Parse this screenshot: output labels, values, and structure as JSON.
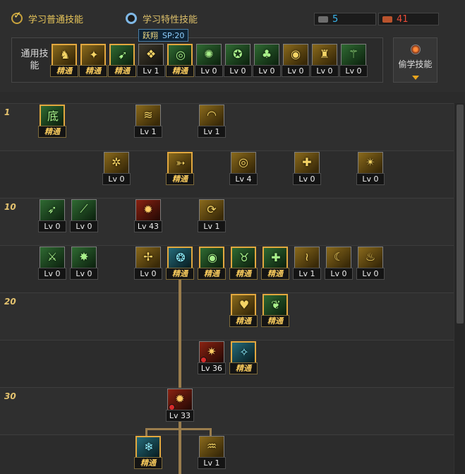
{
  "header": {
    "tabs": [
      {
        "label": "学习普通技能",
        "selected": true
      },
      {
        "label": "学习特性技能",
        "selected": false
      }
    ],
    "resources": [
      {
        "icon": "sp-icon",
        "value": "5",
        "color": "#3ab8f0"
      },
      {
        "icon": "tp-icon",
        "value": "41",
        "color": "#ea4b37"
      }
    ],
    "tooltip": {
      "name": "跃翔",
      "sp": "SP:20"
    },
    "common_label": "通用技能",
    "steal_label": "偷学技能"
  },
  "common_skills": [
    {
      "icon": "kneel-icon",
      "tag": "精通",
      "master": true,
      "style": "gold"
    },
    {
      "icon": "throw-icon",
      "tag": "精通",
      "master": true,
      "style": "gold"
    },
    {
      "icon": "run-icon",
      "tag": "精通",
      "master": true,
      "style": "green"
    },
    {
      "icon": "wing-icon",
      "tag": "Lv 1",
      "master": false,
      "style": "dark"
    },
    {
      "icon": "target-icon",
      "tag": "精通",
      "master": true,
      "style": "green"
    },
    {
      "icon": "aura-icon",
      "tag": "Lv 0",
      "master": false,
      "style": "green"
    },
    {
      "icon": "shout-icon",
      "tag": "Lv 0",
      "master": false,
      "style": "green"
    },
    {
      "icon": "mushroom-icon",
      "tag": "Lv 0",
      "master": false,
      "style": "green"
    },
    {
      "icon": "eye-icon",
      "tag": "Lv 0",
      "master": false,
      "style": "gold"
    },
    {
      "icon": "flex-icon",
      "tag": "Lv 0",
      "master": false,
      "style": "gold"
    },
    {
      "icon": "mage-icon",
      "tag": "Lv 0",
      "master": false,
      "style": "green"
    }
  ],
  "level_labels": [
    "1",
    "",
    "10",
    "",
    "20",
    "",
    "30",
    ""
  ],
  "tree_skills": [
    {
      "row": 0,
      "col": 56,
      "icon": "base-kick-icon",
      "glyph_text": "底",
      "tag": "精通",
      "master": true,
      "style": "green"
    },
    {
      "row": 0,
      "col": 192,
      "icon": "slash-icon",
      "tag": "Lv 1",
      "master": false,
      "style": "gold"
    },
    {
      "row": 0,
      "col": 282,
      "icon": "arc-icon",
      "tag": "Lv 1",
      "master": false,
      "style": "gold"
    },
    {
      "row": 1,
      "col": 147,
      "icon": "burst-icon",
      "tag": "Lv 0",
      "master": false,
      "style": "gold"
    },
    {
      "row": 1,
      "col": 237,
      "icon": "dash-icon",
      "tag": "精通",
      "master": true,
      "style": "gold"
    },
    {
      "row": 1,
      "col": 327,
      "icon": "whirl-icon",
      "tag": "Lv 4",
      "master": false,
      "style": "gold"
    },
    {
      "row": 1,
      "col": 417,
      "icon": "shield-icon",
      "tag": "Lv 0",
      "master": false,
      "style": "gold"
    },
    {
      "row": 1,
      "col": 507,
      "icon": "fan-icon",
      "tag": "Lv 0",
      "master": false,
      "style": "gold"
    },
    {
      "row": 2,
      "col": 56,
      "icon": "spear-icon",
      "tag": "Lv 0",
      "master": false,
      "style": "green"
    },
    {
      "row": 2,
      "col": 101,
      "icon": "blade-icon",
      "tag": "Lv 0",
      "master": false,
      "style": "green"
    },
    {
      "row": 2,
      "col": 192,
      "icon": "fire-icon",
      "tag": "Lv 43",
      "master": false,
      "style": "red"
    },
    {
      "row": 2,
      "col": 282,
      "icon": "spin-icon",
      "tag": "Lv 1",
      "master": false,
      "style": "gold"
    },
    {
      "row": 3,
      "col": 56,
      "icon": "sword-icon",
      "tag": "Lv 0",
      "master": false,
      "style": "green"
    },
    {
      "row": 3,
      "col": 101,
      "icon": "star-burst-icon",
      "tag": "Lv 0",
      "master": false,
      "style": "green"
    },
    {
      "row": 3,
      "col": 192,
      "icon": "cross-slash-icon",
      "tag": "Lv 0",
      "master": false,
      "style": "gold"
    },
    {
      "row": 3,
      "col": 237,
      "icon": "orb-icon",
      "tag": "精通",
      "master": true,
      "style": "cyan"
    },
    {
      "row": 3,
      "col": 282,
      "icon": "green-eye-icon",
      "tag": "精通",
      "master": true,
      "style": "green"
    },
    {
      "row": 3,
      "col": 327,
      "icon": "beast-icon",
      "tag": "精通",
      "master": true,
      "style": "green"
    },
    {
      "row": 3,
      "col": 372,
      "icon": "heal-cross-icon",
      "tag": "精通",
      "master": true,
      "style": "green"
    },
    {
      "row": 3,
      "col": 417,
      "icon": "claw-icon",
      "tag": "Lv 1",
      "master": false,
      "style": "gold"
    },
    {
      "row": 3,
      "col": 462,
      "icon": "moon-icon",
      "tag": "Lv 0",
      "master": false,
      "style": "gold"
    },
    {
      "row": 3,
      "col": 507,
      "icon": "flame-icon",
      "tag": "Lv 0",
      "master": false,
      "style": "gold"
    },
    {
      "row": 4,
      "col": 327,
      "icon": "heart-shield-icon",
      "tag": "精通",
      "master": true,
      "style": "gold"
    },
    {
      "row": 4,
      "col": 372,
      "icon": "vine-icon",
      "tag": "精通",
      "master": true,
      "style": "green"
    },
    {
      "row": 5,
      "col": 282,
      "icon": "explode-icon",
      "tag": "Lv 36",
      "master": false,
      "style": "red",
      "warn": true
    },
    {
      "row": 5,
      "col": 327,
      "icon": "ice-warrior-icon",
      "tag": "精通",
      "master": true,
      "style": "cyan"
    },
    {
      "row": 6,
      "col": 237,
      "icon": "ultimate-icon",
      "tag": "Lv 33",
      "master": false,
      "style": "red",
      "warn": true
    },
    {
      "row": 7,
      "col": 192,
      "icon": "frost-beast-icon",
      "tag": "精通",
      "master": true,
      "style": "cyan"
    },
    {
      "row": 7,
      "col": 282,
      "icon": "tornado-icon",
      "tag": "Lv 1",
      "master": false,
      "style": "gold"
    }
  ]
}
